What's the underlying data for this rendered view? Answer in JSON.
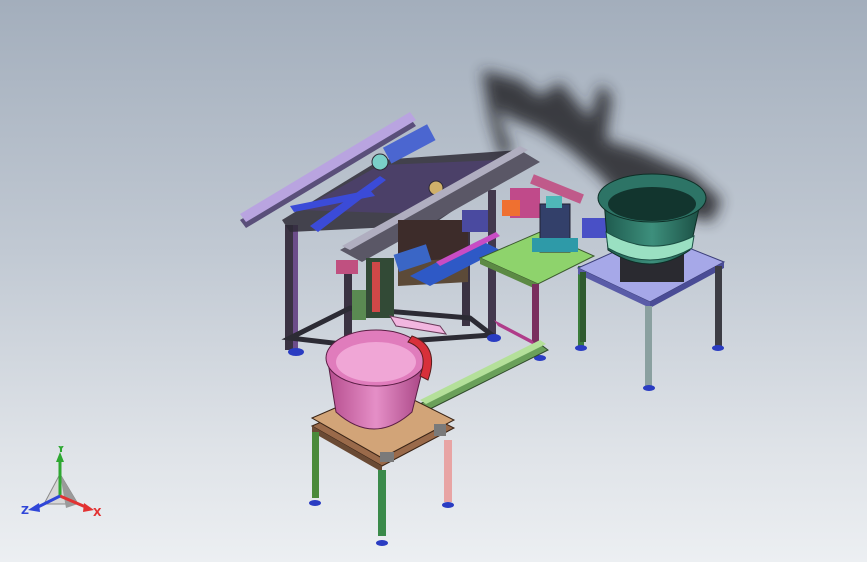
{
  "view": {
    "background_top": "#a3aebc",
    "background_bottom": "#eceff2"
  },
  "triad": {
    "x_label": "X",
    "y_label": "Y",
    "z_label": "Z",
    "x_color": "#e23232",
    "y_color": "#2ea832",
    "z_color": "#2f46d8"
  },
  "model": {
    "parts": [
      "main-frame",
      "top-rail",
      "conveyor-track",
      "mounting-plate",
      "pink-bowl-feeder",
      "green-bowl-feeder",
      "feeder-stand-left",
      "feeder-stand-right",
      "linear-feed-track"
    ]
  }
}
